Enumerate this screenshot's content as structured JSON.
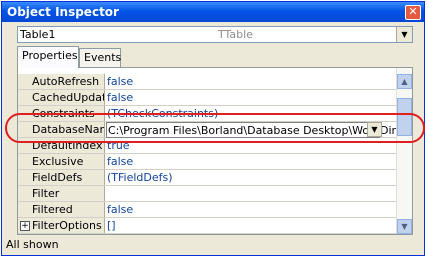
{
  "window": {
    "title": "Object Inspector"
  },
  "object_selector": {
    "name": "Table1",
    "type": "TTable"
  },
  "tabs": [
    {
      "label": "Properties"
    },
    {
      "label": "Events"
    }
  ],
  "properties": [
    {
      "name": "AutoRefresh",
      "value": "false"
    },
    {
      "name": "CachedUpdate",
      "value": "false"
    },
    {
      "name": "Constraints",
      "value": "(TCheckConstraints)"
    },
    {
      "name": "DatabaseName",
      "value": "C:\\Program Files\\Borland\\Database Desktop\\WorkDir"
    },
    {
      "name": "DefaultIndex",
      "value": "true"
    },
    {
      "name": "Exclusive",
      "value": "false"
    },
    {
      "name": "FieldDefs",
      "value": "(TFieldDefs)"
    },
    {
      "name": "Filter",
      "value": ""
    },
    {
      "name": "Filtered",
      "value": "false"
    },
    {
      "name": "FilterOptions",
      "value": "[]"
    }
  ],
  "status": {
    "text": "All shown"
  },
  "colors": {
    "title_bar": "#0454e6",
    "highlight": "#e02020",
    "value_text": "#10449c"
  }
}
